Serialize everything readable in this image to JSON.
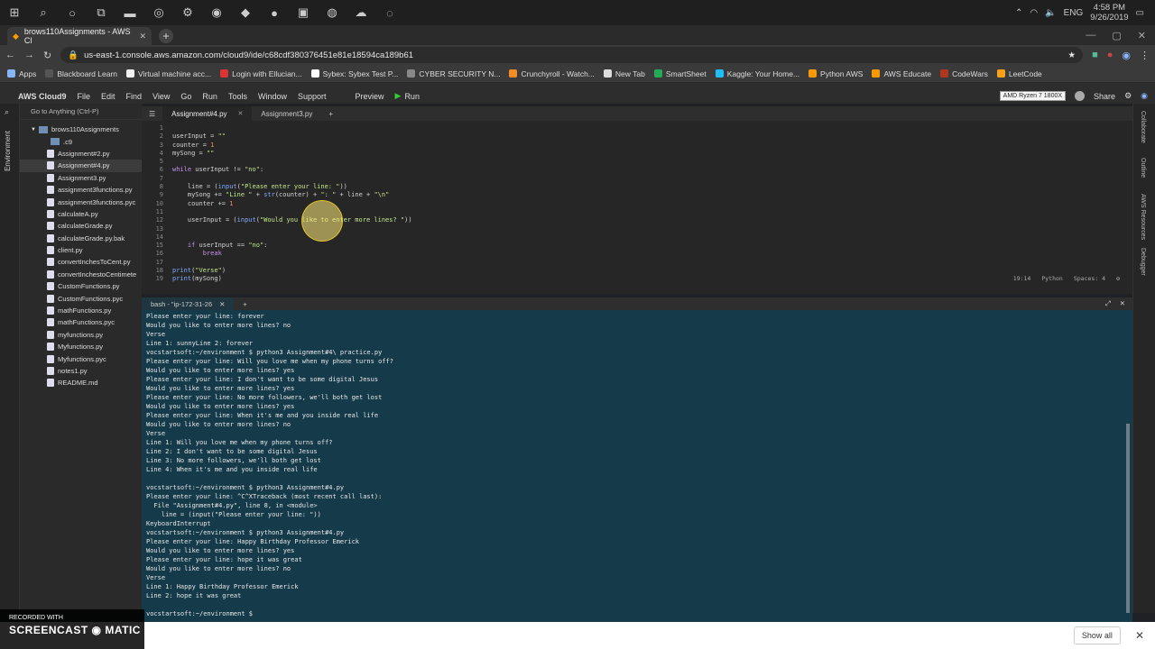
{
  "taskbar": {
    "icons": [
      "windows-icon",
      "search-icon",
      "cortana-icon",
      "task-view-icon",
      "file-explorer-icon",
      "chrome-icon",
      "steam-icon",
      "spotify-icon",
      "app-icon",
      "origin-icon",
      "app2-icon",
      "obs-icon",
      "onedrive-icon",
      "app3-icon"
    ],
    "lang": "ENG",
    "time": "4:58 PM",
    "date": "9/26/2019"
  },
  "browser": {
    "tab_title": "brows110Assignments - AWS Cl",
    "url": "us-east-1.console.aws.amazon.com/cloud9/ide/c68cdf380376451e81e18594ca189b61",
    "bookmarks": [
      {
        "label": "Apps",
        "color": "#8ab4f8"
      },
      {
        "label": "Blackboard Learn",
        "color": "#555"
      },
      {
        "label": "Virtual machine acc...",
        "color": "#f2f2f2"
      },
      {
        "label": "Login with Ellucian...",
        "color": "#d33"
      },
      {
        "label": "Sybex: Sybex Test P...",
        "color": "#fff"
      },
      {
        "label": "CYBER SECURITY N...",
        "color": "#888"
      },
      {
        "label": "Crunchyroll - Watch...",
        "color": "#f78b24"
      },
      {
        "label": "New Tab",
        "color": "#ddd"
      },
      {
        "label": "SmartSheet",
        "color": "#2a5"
      },
      {
        "label": "Kaggle: Your Home...",
        "color": "#20beff"
      },
      {
        "label": "Python AWS",
        "color": "#f90"
      },
      {
        "label": "AWS Educate",
        "color": "#f90"
      },
      {
        "label": "CodeWars",
        "color": "#b1361e"
      },
      {
        "label": "LeetCode",
        "color": "#ffa116"
      }
    ]
  },
  "c9": {
    "brand": "AWS Cloud9",
    "menu": [
      "File",
      "Edit",
      "Find",
      "View",
      "Go",
      "Run",
      "Tools",
      "Window",
      "Support"
    ],
    "preview": "Preview",
    "run": "Run",
    "share": "Share",
    "tooltip": "AMD Ryzen 7 1800X",
    "goto_placeholder": "Go to Anything (Ctrl-P)",
    "left_rail_label": "Environment",
    "right_rail_labels": [
      "Collaborate",
      "Outline",
      "AWS Resources",
      "Debugger"
    ]
  },
  "filetree": {
    "root": "brows110Assignments",
    "items": [
      ".c9",
      "Assignment#2.py",
      "Assignment#4.py",
      "Assignment3.py",
      "assignment3functions.py",
      "assignment3functions.pyc",
      "calculateA.py",
      "calculateGrade.py",
      "calculateGrade.py.bak",
      "client.py",
      "convertInchesToCent.py",
      "convertInchestoCentimete",
      "CustomFunctions.py",
      "CustomFunctions.pyc",
      "mathFunctions.py",
      "mathFunctions.pyc",
      "myfunctions.py",
      "Myfunctions.py",
      "Myfunctions.pyc",
      "notes1.py",
      "README.md"
    ],
    "selected_index": 2
  },
  "editor": {
    "tabs": [
      {
        "label": "Assignment#4.py",
        "active": true
      },
      {
        "label": "Assignment3.py",
        "active": false
      }
    ],
    "line_numbers": [
      "1",
      "2",
      "3",
      "4",
      "5",
      "6",
      "7",
      "8",
      "9",
      "10",
      "11",
      "12",
      "13",
      "14",
      "15",
      "16",
      "17",
      "18",
      "19"
    ],
    "status_pos": "19:14",
    "status_lang": "Python",
    "status_spaces": "Spaces: 4"
  },
  "terminal": {
    "tab_label": "bash - \"ip-172-31-26",
    "lines": [
      "Please enter your line: forever",
      "Would you like to enter more lines? no",
      "Verse",
      "Line 1: sunnyLine 2: forever",
      "vocstartsoft:~/environment $ python3 Assignment#4\\ practice.py",
      "Please enter your line: Will you love me when my phone turns off?",
      "Would you like to enter more lines? yes",
      "Please enter your line: I don't want to be some digital Jesus",
      "Would you like to enter more lines? yes",
      "Please enter your line: No more followers, we'll both get lost",
      "Would you like to enter more lines? yes",
      "Please enter your line: When it's me and you inside real life",
      "Would you like to enter more lines? no",
      "Verse",
      "Line 1: Will you love me when my phone turns off?",
      "Line 2: I don't want to be some digital Jesus",
      "Line 3: No more followers, we'll both get lost",
      "Line 4: When it's me and you inside real life",
      "",
      "vocstartsoft:~/environment $ python3 Assignment#4.py",
      "Please enter your line: ^C^XTraceback (most recent call last):",
      "  File \"Assignment#4.py\", line 8, in <module>",
      "    line = (input(\"Please enter your line: \"))",
      "KeyboardInterrupt",
      "vocstartsoft:~/environment $ python3 Assignment#4.py",
      "Please enter your line: Happy Birthday Professor Emerick",
      "Would you like to enter more lines? yes",
      "Please enter your line: hope it was great",
      "Would you like to enter more lines? no",
      "Verse",
      "Line 1: Happy Birthday Professor Emerick",
      "Line 2: hope it was great",
      "",
      "vocstartsoft:~/environment $ "
    ]
  },
  "download_bar": {
    "show_all": "Show all"
  },
  "watermark": {
    "line1": "RECORDED WITH",
    "line2": "SCREENCAST",
    "line3": "MATIC"
  }
}
